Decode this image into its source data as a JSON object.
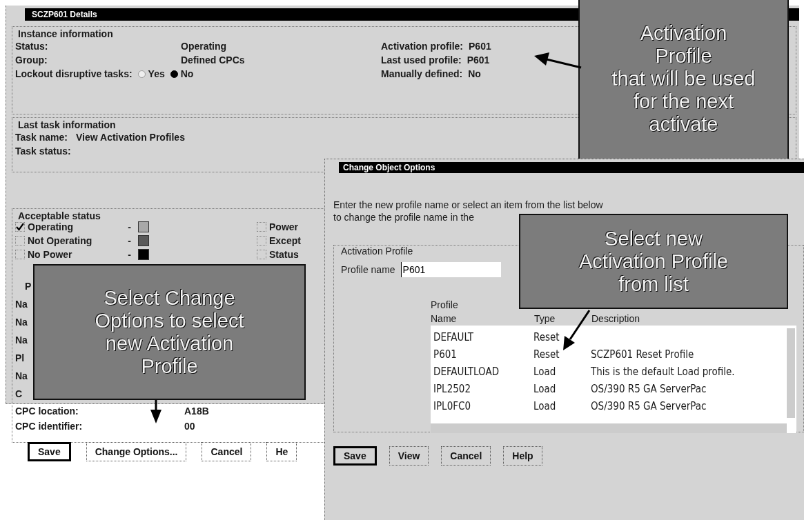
{
  "details_window": {
    "title": "SCZP601 Details",
    "instance_information": {
      "label": "Instance information",
      "fields": [
        {
          "label": "Status:",
          "value": "Operating"
        },
        {
          "label": "Group:",
          "value": "Defined CPCs"
        }
      ],
      "lockout": {
        "label": "Lockout disruptive tasks:",
        "options": [
          {
            "label": "Yes",
            "selected": false
          },
          {
            "label": "No",
            "selected": true
          }
        ]
      },
      "profile_fields": [
        {
          "label": "Activation profile:",
          "value": "P601"
        },
        {
          "label": "Last used profile:",
          "value": "P601"
        },
        {
          "label": "Manually defined:",
          "value": "No"
        }
      ]
    },
    "last_task_information": {
      "label": "Last task information",
      "task_name": {
        "label": "Task name:",
        "value": "View Activation Profiles"
      },
      "task_status": {
        "label": "Task status:"
      }
    },
    "acceptable_status": {
      "label": "Acceptable status",
      "items": [
        {
          "label": "Operating",
          "dash": "-",
          "checked": true,
          "color": "#a8a8a8"
        },
        {
          "label": "Not Operating",
          "dash": "-",
          "checked": false,
          "color": "#5a5a5a"
        },
        {
          "label": "No Power",
          "dash": "-",
          "checked": false,
          "color": "#000000"
        }
      ],
      "items_right": [
        {
          "label": "Power",
          "checked": false
        },
        {
          "label": "Except",
          "checked": false
        },
        {
          "label": "Status",
          "checked": false
        }
      ]
    },
    "obscured_section": {
      "label": "P",
      "rows": [
        "Na",
        "Na",
        "Na",
        "Pl",
        "Na",
        "C"
      ]
    },
    "cpc_fields": [
      {
        "label": "CPC location:",
        "value": "A18B"
      },
      {
        "label": "CPC identifier:",
        "value": "00"
      }
    ],
    "buttons": [
      {
        "label": "Save",
        "default": true
      },
      {
        "label": "Change Options...",
        "default": false
      },
      {
        "label": "Cancel",
        "default": false
      },
      {
        "label": "He",
        "default": false
      }
    ]
  },
  "change_object_options_window": {
    "title": "Change Object Options",
    "instructions": [
      "Enter the new profile name or select an item from the list below",
      "to change the profile name in the"
    ],
    "group_label": "Activation Profile",
    "profile_name": {
      "label": "Profile name",
      "value": "P601"
    },
    "list": {
      "columns": [
        "Profile Name",
        "Type",
        "Description"
      ],
      "rows": [
        [
          "DEFAULT",
          "Reset"
        ],
        [
          "P601",
          "Reset",
          "SCZP601 Reset Profile"
        ],
        [
          "DEFAULTLOAD",
          "Load",
          "This is the default Load profile."
        ],
        [
          "IPL2502",
          "Load",
          "OS/390 R5 GA ServerPac"
        ],
        [
          "IPL0FC0",
          "Load",
          "OS/390 R5 GA ServerPac"
        ]
      ]
    },
    "buttons": [
      {
        "label": "Save",
        "default": true
      },
      {
        "label": "View",
        "default": false
      },
      {
        "label": "Cancel",
        "default": false
      },
      {
        "label": "Help",
        "default": false
      }
    ]
  },
  "callouts": [
    {
      "text": "Activation\nProfile\nthat will be used\nfor the next\nactivate"
    },
    {
      "text": "Select Change\nOptions to select\nnew Activation\nProfile"
    },
    {
      "text": "Select  new\nActivation Profile\nfrom list"
    }
  ]
}
